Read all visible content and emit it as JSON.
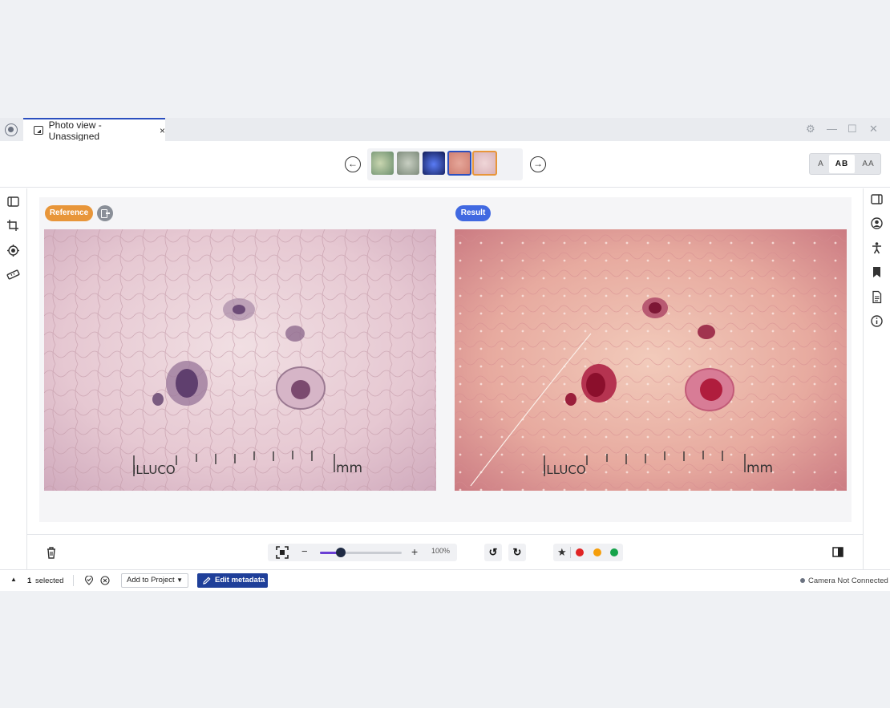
{
  "tab": {
    "title": "Photo view - Unassigned",
    "close": "×"
  },
  "window_controls": {
    "settings": "⚙",
    "minimize": "—",
    "maximize": "☐",
    "close": "✕"
  },
  "toolbar": {
    "prev": "←",
    "next": "→",
    "thumbnails": [
      {
        "name": "thumb-1",
        "color": "#8aa88e"
      },
      {
        "name": "thumb-2",
        "color": "#9da69a"
      },
      {
        "name": "thumb-3",
        "color": "#1c2a6b"
      },
      {
        "name": "thumb-4",
        "color": "#d89a8e"
      },
      {
        "name": "thumb-5",
        "color": "#e6c9c7"
      }
    ],
    "view_modes": [
      "A",
      "AB",
      "AA"
    ],
    "active_mode": "AB"
  },
  "compare": {
    "reference_label": "Reference",
    "result_label": "Result",
    "reference_accent": "#e8963a",
    "result_accent": "#4169e1",
    "image_brand": "ILLUCO",
    "image_unit": "mm"
  },
  "bottom": {
    "zoom_minus": "−",
    "zoom_plus": "+",
    "zoom_level": "100%",
    "zoom_fraction": 0.25,
    "rotate_left": "↺",
    "rotate_right": "↻",
    "star": "★",
    "colors": [
      "#e02424",
      "#f59e0b",
      "#16a34a"
    ]
  },
  "status": {
    "expand": "▲",
    "selected_count": "1",
    "selected_label": "selected",
    "add_to_project": "Add to Project",
    "edit_metadata": "Edit metadata",
    "camera_status": "Camera Not Connected"
  }
}
